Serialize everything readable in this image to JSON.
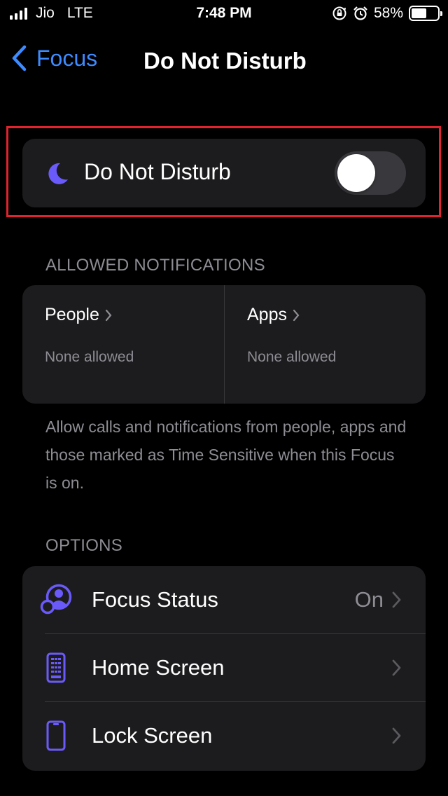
{
  "status_bar": {
    "carrier": "Jio",
    "network": "LTE",
    "time": "7:48 PM",
    "battery": "58%",
    "battery_level": 0.58,
    "icons": [
      "signal-icon",
      "orientation-lock-icon",
      "alarm-icon",
      "battery-icon"
    ]
  },
  "nav": {
    "back_label": "Focus",
    "title": "Do Not Disturb"
  },
  "dnd": {
    "label": "Do Not Disturb",
    "enabled": false,
    "icon": "moon-icon"
  },
  "allowed": {
    "header": "ALLOWED NOTIFICATIONS",
    "people": {
      "title": "People",
      "sub": "None allowed"
    },
    "apps": {
      "title": "Apps",
      "sub": "None allowed"
    },
    "footer": "Allow calls and notifications from people, apps and those marked as Time Sensitive when this Focus is on."
  },
  "options": {
    "header": "OPTIONS",
    "items": [
      {
        "label": "Focus Status",
        "value": "On",
        "icon": "focus-status-icon"
      },
      {
        "label": "Home Screen",
        "value": "",
        "icon": "home-screen-icon"
      },
      {
        "label": "Lock Screen",
        "value": "",
        "icon": "lock-screen-icon"
      }
    ]
  },
  "colors": {
    "accent": "#3d8bff",
    "icon_purple": "#6a5af9",
    "highlight": "#e0232d",
    "card_bg": "#1c1c1e",
    "secondary_text": "#8d8d93"
  }
}
